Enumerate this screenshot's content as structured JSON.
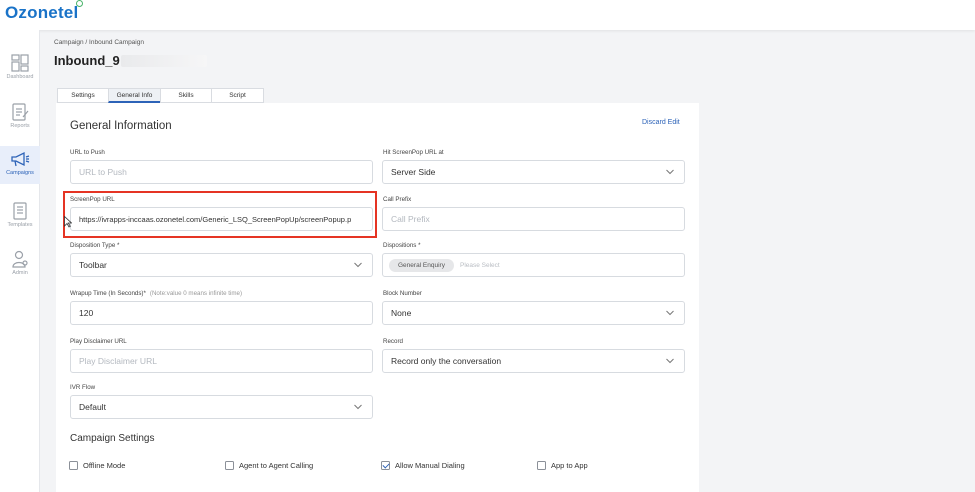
{
  "app": {
    "logo": "Ozonetel"
  },
  "sidebar": {
    "items": [
      {
        "label": "Dashboard",
        "icon": "dashboard-icon"
      },
      {
        "label": "Reports",
        "icon": "reports-icon"
      },
      {
        "label": "Campaigns",
        "icon": "megaphone-icon",
        "active": true
      },
      {
        "label": "Templates",
        "icon": "templates-icon"
      },
      {
        "label": "Admin",
        "icon": "admin-icon"
      }
    ]
  },
  "breadcrumb": "Campaign / Inbound Campaign",
  "page_title": "Inbound_9",
  "tabs": [
    {
      "label": "Settings"
    },
    {
      "label": "General Info",
      "active": true
    },
    {
      "label": "Skills"
    },
    {
      "label": "Script"
    }
  ],
  "section": {
    "title": "General Information",
    "discard_label": "Discard Edit",
    "settings_title": "Campaign Settings"
  },
  "fields": {
    "url_to_push": {
      "label": "URL to Push",
      "placeholder": "URL to Push",
      "value": ""
    },
    "hit_screenpop": {
      "label": "Hit ScreenPop URL at",
      "value": "Server Side"
    },
    "screenpop_url": {
      "label": "ScreenPop URL",
      "value": "https://ivrapps-inccaas.ozonetel.com/Generic_LSQ_ScreenPopUp/screenPopup.p"
    },
    "call_prefix": {
      "label": "Call Prefix",
      "placeholder": "Call Prefix",
      "value": ""
    },
    "disposition_type": {
      "label": "Disposition Type *",
      "value": "Toolbar"
    },
    "dispositions": {
      "label": "Dispositions *",
      "chip": "General Enquiry",
      "placeholder": "Please Select"
    },
    "wrapup_time": {
      "label": "Wrapup Time (In Seconds)*",
      "note": "(Note:value 0 means infinite time)",
      "value": "120"
    },
    "block_number": {
      "label": "Block Number",
      "value": "None"
    },
    "play_disclaimer": {
      "label": "Play Disclaimer URL",
      "placeholder": "Play Disclaimer URL",
      "value": ""
    },
    "record": {
      "label": "Record",
      "value": "Record only the conversation"
    },
    "ivr_flow": {
      "label": "IVR Flow",
      "value": "Default"
    }
  },
  "campaign_settings": [
    {
      "label": "Offline Mode",
      "checked": false
    },
    {
      "label": "Agent to Agent Calling",
      "checked": false
    },
    {
      "label": "Allow Manual Dialing",
      "checked": true
    },
    {
      "label": "App to App",
      "checked": false
    }
  ],
  "colors": {
    "accent": "#2d63b8",
    "highlight": "#e53424",
    "brand": "#1a73c8"
  }
}
